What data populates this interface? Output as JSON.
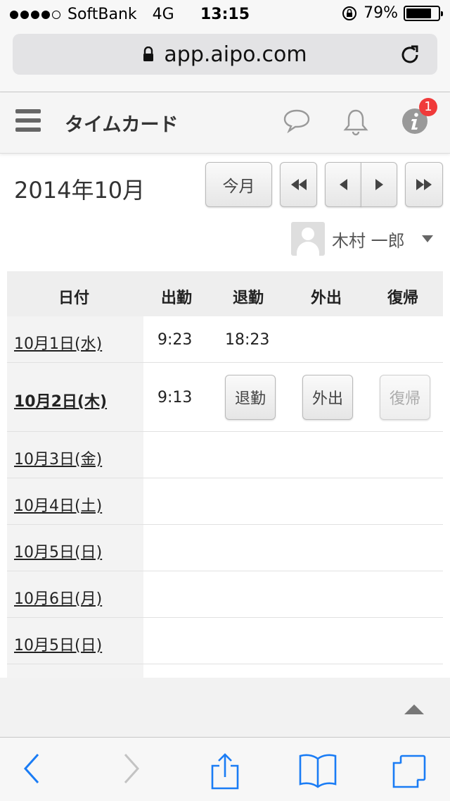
{
  "status": {
    "carrier": "SoftBank",
    "network": "4G",
    "time": "13:15",
    "battery": "79%",
    "battery_fraction": 0.79
  },
  "browser": {
    "url": "app.aipo.com"
  },
  "header": {
    "title": "タイムカード",
    "notification_count": "1"
  },
  "month": {
    "title": "2014年10月",
    "today_label": "今月"
  },
  "user": {
    "name": "木村 一郎"
  },
  "table": {
    "headers": [
      "日付",
      "出勤",
      "退勤",
      "外出",
      "復帰"
    ],
    "rows": [
      {
        "date": "10月1日(水)",
        "in": "9:23",
        "out": "18:23"
      },
      {
        "date": "10月2日(木)",
        "in": "9:13",
        "out_btn": "退勤",
        "away_btn": "外出",
        "return_btn": "復帰"
      },
      {
        "date": "10月3日(金)"
      },
      {
        "date": "10月4日(土)"
      },
      {
        "date": "10月5日(日)"
      },
      {
        "date": "10月6日(月)"
      },
      {
        "date": "10月5日(日)"
      }
    ]
  },
  "colors": {
    "badge": "#f03a3a",
    "ios_blue": "#1a7cf5"
  }
}
